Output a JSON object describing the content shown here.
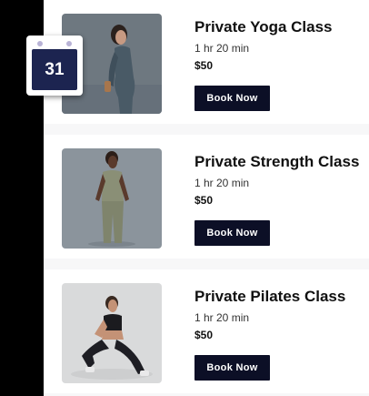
{
  "classes": [
    {
      "title": "Private Yoga Class",
      "duration": "1 hr 20 min",
      "price": "$50",
      "button": "Book Now"
    },
    {
      "title": "Private Strength Class",
      "duration": "1 hr 20 min",
      "price": "$50",
      "button": "Book Now"
    },
    {
      "title": "Private Pilates Class",
      "duration": "1 hr 20 min",
      "price": "$50",
      "button": "Book Now"
    }
  ],
  "calendar": {
    "day": "31"
  },
  "colors": {
    "button_bg": "#0c0f26",
    "calendar_face": "#1c2450",
    "panel_bg": "#f7f7f8"
  }
}
